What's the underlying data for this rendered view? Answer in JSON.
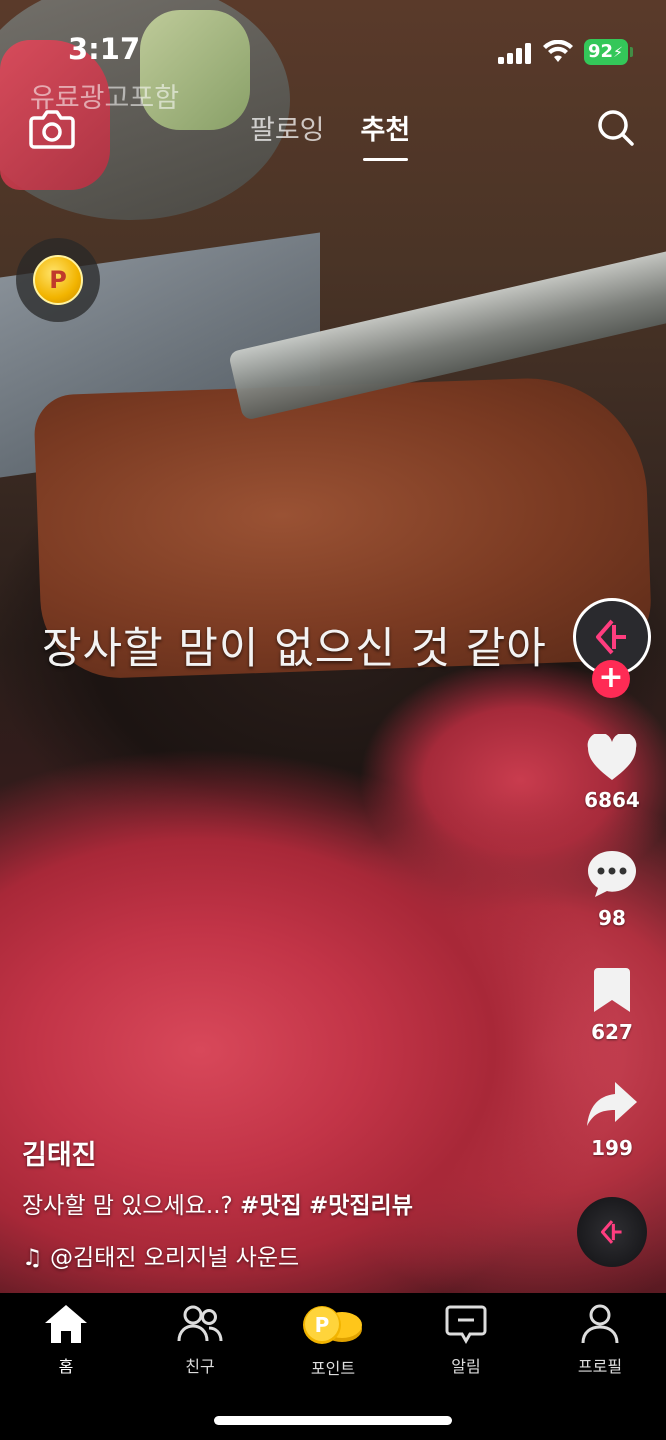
{
  "status_bar": {
    "time": "3:17",
    "battery": "92"
  },
  "header": {
    "ad_label": "유료광고포함",
    "tabs": [
      {
        "label": "팔로잉"
      },
      {
        "label": "추천"
      }
    ],
    "active_tab": "추천"
  },
  "video": {
    "caption_text": "장사할 맘이 없으신 것 같아"
  },
  "actions": {
    "likes": "6864",
    "comments": "98",
    "saves": "627",
    "shares": "199"
  },
  "post": {
    "author": "김태진",
    "description": "장사할 맘 있으세요..?",
    "hashtags": [
      "#맛집",
      "#맛집리뷰"
    ],
    "sound": "@김태진 오리지널 사운드"
  },
  "bottom_nav": {
    "items": [
      {
        "label": "홈",
        "icon": "home-icon"
      },
      {
        "label": "친구",
        "icon": "friends-icon"
      },
      {
        "label": "포인트",
        "icon": "points-icon"
      },
      {
        "label": "알림",
        "icon": "inbox-icon"
      },
      {
        "label": "프로필",
        "icon": "profile-icon"
      }
    ]
  },
  "colors": {
    "accent": "#ff2b55",
    "battery": "#34c759",
    "coin": "#f2b400"
  }
}
